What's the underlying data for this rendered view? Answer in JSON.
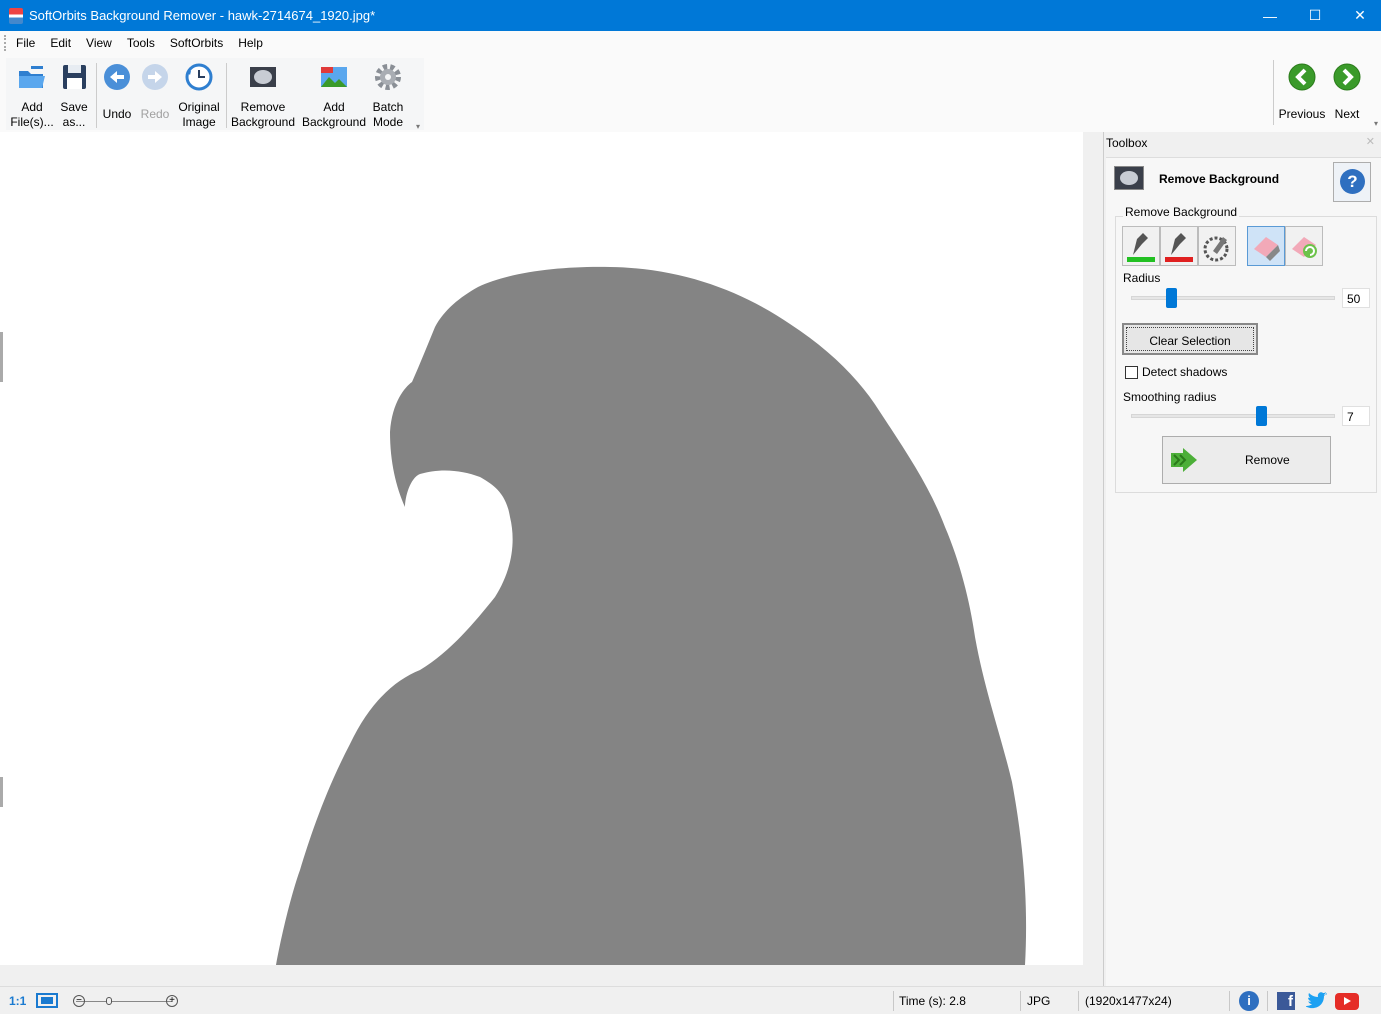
{
  "window": {
    "title": "SoftOrbits Background Remover - hawk-2714674_1920.jpg*",
    "minimize": "—",
    "maximize": "☐",
    "close": "✕"
  },
  "menu": [
    "File",
    "Edit",
    "View",
    "Tools",
    "SoftOrbits",
    "Help"
  ],
  "toolbar": {
    "add_files": [
      "Add",
      "File(s)..."
    ],
    "save_as": [
      "Save",
      "as..."
    ],
    "undo": "Undo",
    "redo": "Redo",
    "original_image": [
      "Original",
      "Image"
    ],
    "remove_background": [
      "Remove",
      "Background"
    ],
    "add_background": [
      "Add",
      "Background"
    ],
    "batch_mode": [
      "Batch",
      "Mode"
    ],
    "previous": "Previous",
    "next": "Next"
  },
  "toolbox": {
    "header": "Toolbox",
    "section_title": "Remove Background",
    "help_glyph": "?",
    "group_label": "Remove Background",
    "radius_label": "Radius",
    "radius_value": "50",
    "radius_level": 0.18,
    "clear_selection": "Clear Selection",
    "detect_shadows": "Detect shadows",
    "detect_shadows_checked": false,
    "smoothing_label": "Smoothing radius",
    "smoothing_value": "7",
    "smoothing_level": 0.65,
    "remove_button": "Remove"
  },
  "status": {
    "zoom_1to1": "1:1",
    "time": "Time (s): 2.8",
    "format": "JPG",
    "dimensions": "(1920x1477x24)"
  },
  "colors": {
    "titlebar": "#0078d7",
    "silhouette": "#848484",
    "accent": "#0078d7",
    "nav_green": "#3a9a2a"
  }
}
